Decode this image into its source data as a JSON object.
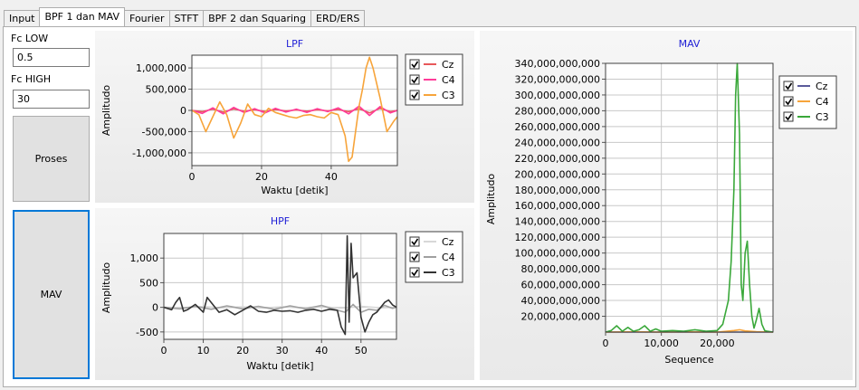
{
  "tabs": [
    "Input",
    "BPF 1 dan MAV",
    "Fourier",
    "STFT",
    "BPF 2 dan Squaring",
    "ERD/ERS"
  ],
  "active_tab": 1,
  "form": {
    "fc_low_label": "Fc LOW",
    "fc_low_value": "0.5",
    "fc_high_label": "Fc HIGH",
    "fc_high_value": "30",
    "proses_label": "Proses",
    "mav_label": "MAV"
  },
  "colors": {
    "cz_lpf": "#e8585a",
    "c4_lpf": "#ff3c9a",
    "c3_lpf": "#f7a43a",
    "title_blue": "#1f1fd6",
    "focus_border": "#0078d7"
  },
  "chart_data": [
    {
      "type": "line",
      "title": "LPF",
      "xlabel": "Waktu [detik]",
      "ylabel": "Amplitudo",
      "xlim": [
        0,
        59
      ],
      "ylim": [
        -1300000,
        1300000
      ],
      "xticks": [
        "0",
        "20",
        "40"
      ],
      "yticks": [
        "1,000,000",
        "500,000",
        "0",
        "-500,000",
        "-1,000,000"
      ],
      "legend": "right",
      "series": [
        {
          "name": "Cz",
          "color": "#e8585a",
          "x": [
            0,
            3,
            6,
            9,
            12,
            15,
            18,
            21,
            24,
            27,
            30,
            33,
            36,
            39,
            42,
            45,
            48,
            51,
            54,
            57,
            59
          ],
          "y": [
            0,
            -30000,
            30000,
            -40000,
            35000,
            -20000,
            15000,
            -25000,
            20000,
            -15000,
            10000,
            -20000,
            15000,
            -10000,
            20000,
            -30000,
            40000,
            -60000,
            50000,
            -30000,
            0
          ]
        },
        {
          "name": "C4",
          "color": "#ff3c9a",
          "x": [
            0,
            3,
            6,
            9,
            12,
            15,
            18,
            21,
            24,
            27,
            30,
            33,
            36,
            39,
            42,
            45,
            48,
            51,
            54,
            57,
            59
          ],
          "y": [
            0,
            -70000,
            60000,
            -80000,
            70000,
            -50000,
            40000,
            -60000,
            50000,
            -40000,
            30000,
            -50000,
            40000,
            -30000,
            60000,
            -80000,
            100000,
            -120000,
            90000,
            -60000,
            0
          ]
        },
        {
          "name": "C3",
          "color": "#f7a43a",
          "x": [
            0,
            2,
            4,
            6,
            8,
            10,
            12,
            14,
            16,
            18,
            20,
            22,
            24,
            26,
            28,
            30,
            32,
            34,
            36,
            38,
            40,
            42,
            44,
            45,
            46,
            47,
            48,
            49,
            50,
            51,
            52,
            54,
            56,
            58,
            59
          ],
          "y": [
            0,
            -100000,
            -500000,
            -150000,
            200000,
            -100000,
            -650000,
            -300000,
            150000,
            -100000,
            -150000,
            50000,
            -50000,
            -100000,
            -150000,
            -180000,
            -120000,
            -100000,
            -150000,
            -180000,
            -50000,
            -100000,
            -600000,
            -1200000,
            -1100000,
            -500000,
            100000,
            500000,
            1000000,
            1250000,
            1000000,
            300000,
            -500000,
            -250000,
            -150000
          ]
        }
      ]
    },
    {
      "type": "line",
      "title": "HPF",
      "xlabel": "Waktu [detik]",
      "ylabel": "Amplitudo",
      "xlim": [
        0,
        59
      ],
      "ylim": [
        -650,
        1500
      ],
      "xticks": [
        "0",
        "10",
        "20",
        "30",
        "40",
        "50"
      ],
      "yticks": [
        "1,000",
        "500",
        "0",
        "-500"
      ],
      "legend": "right",
      "series": [
        {
          "name": "Cz",
          "color": "#d8d8d8",
          "x": [
            0,
            5,
            10,
            15,
            20,
            25,
            30,
            35,
            40,
            45,
            50,
            55,
            59
          ],
          "y": [
            0,
            -10,
            15,
            -10,
            10,
            -15,
            10,
            -10,
            15,
            -20,
            20,
            -10,
            0
          ]
        },
        {
          "name": "C4",
          "color": "#a0a0a0",
          "x": [
            0,
            4,
            8,
            12,
            16,
            20,
            24,
            28,
            32,
            36,
            40,
            44,
            46,
            48,
            50,
            52,
            54,
            56,
            58,
            59
          ],
          "y": [
            0,
            -30,
            20,
            -40,
            30,
            -30,
            20,
            -40,
            30,
            -30,
            40,
            -60,
            -100,
            60,
            -100,
            -40,
            -60,
            40,
            -20,
            0
          ]
        },
        {
          "name": "C3",
          "color": "#333333",
          "x": [
            0,
            2,
            3,
            4,
            5,
            6,
            8,
            10,
            11,
            12,
            14,
            16,
            18,
            20,
            22,
            24,
            26,
            28,
            30,
            32,
            34,
            36,
            38,
            40,
            42,
            44,
            45,
            46,
            46.5,
            47,
            47.5,
            48,
            49,
            50,
            51,
            52,
            53,
            54,
            56,
            57,
            58,
            59
          ],
          "y": [
            0,
            -50,
            100,
            200,
            -80,
            -50,
            60,
            -100,
            200,
            100,
            -100,
            -50,
            -150,
            -60,
            30,
            -80,
            -100,
            -60,
            -80,
            -70,
            -100,
            -60,
            -40,
            -80,
            -40,
            -60,
            -400,
            -550,
            1450,
            -300,
            1300,
            600,
            700,
            -200,
            -500,
            -300,
            -150,
            -100,
            100,
            150,
            50,
            0
          ]
        }
      ]
    },
    {
      "type": "line",
      "title": "MAV",
      "xlabel": "Sequence",
      "ylabel": "Amplitudo",
      "xlim": [
        0,
        30000
      ],
      "ylim": [
        0,
        340000000000
      ],
      "xticks": [
        "0",
        "10,000",
        "20,000"
      ],
      "yticks": [
        "340,000,000,000",
        "320,000,000,000",
        "300,000,000,000",
        "280,000,000,000",
        "260,000,000,000",
        "240,000,000,000",
        "220,000,000,000",
        "200,000,000,000",
        "180,000,000,000",
        "160,000,000,000",
        "140,000,000,000",
        "120,000,000,000",
        "100,000,000,000",
        "80,000,000,000",
        "60,000,000,000",
        "40,000,000,000",
        "20,000,000,000"
      ],
      "legend": "top-right",
      "series": [
        {
          "name": "Cz",
          "color": "#5a5a9a",
          "x": [
            0,
            30000
          ],
          "y": [
            0,
            0
          ]
        },
        {
          "name": "C4",
          "color": "#f7a43a",
          "x": [
            0,
            5000,
            10000,
            15000,
            20000,
            23000,
            24000,
            25000,
            27000,
            30000
          ],
          "y": [
            0,
            300000000,
            0,
            200000000,
            0,
            2000000000,
            3000000000,
            1500000000,
            500000000,
            0
          ]
        },
        {
          "name": "C3",
          "color": "#3aa83a",
          "x": [
            0,
            1000,
            2000,
            3000,
            4000,
            5000,
            6000,
            7000,
            8000,
            9000,
            10000,
            12000,
            14000,
            16000,
            18000,
            20000,
            21000,
            22000,
            22500,
            23000,
            23300,
            23600,
            24000,
            24300,
            24600,
            25000,
            25400,
            25800,
            26200,
            26600,
            27000,
            27500,
            28000,
            28500,
            29000,
            30000
          ],
          "y": [
            0,
            2000000000,
            8000000000,
            1000000000,
            6000000000,
            1000000000,
            3000000000,
            8000000000,
            1000000000,
            4000000000,
            1000000000,
            2000000000,
            1000000000,
            3000000000,
            1000000000,
            2000000000,
            10000000000,
            40000000000,
            90000000000,
            180000000000,
            300000000000,
            340000000000,
            250000000000,
            60000000000,
            40000000000,
            100000000000,
            115000000000,
            60000000000,
            20000000000,
            5000000000,
            15000000000,
            30000000000,
            10000000000,
            2000000000,
            1000000000,
            0
          ]
        }
      ]
    }
  ]
}
